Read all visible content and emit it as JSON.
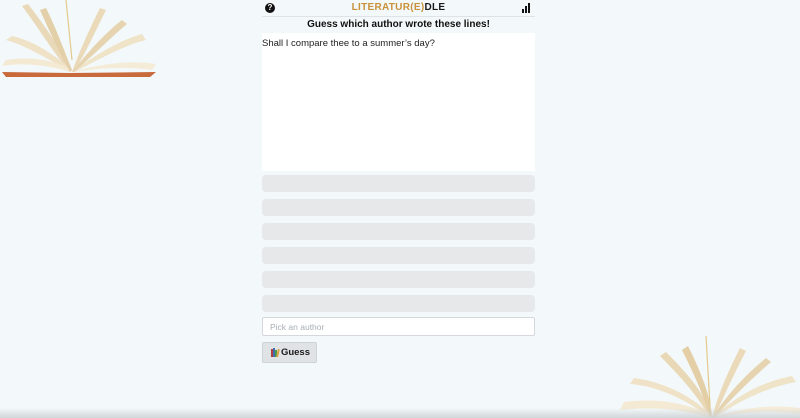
{
  "header": {
    "logo_accent": "LITERATUR(E)",
    "logo_plain": "DLE",
    "help_icon": "question-circle-icon",
    "stats_icon": "bar-chart-icon"
  },
  "prompt": {
    "title": "Guess which author wrote these lines!",
    "quote": "Shall I compare thee to a summer’s day?"
  },
  "guesses": [
    "",
    "",
    "",
    "",
    "",
    ""
  ],
  "input": {
    "placeholder": "Pick an author",
    "value": ""
  },
  "guess_button": {
    "icon": "books-icon",
    "label": "Guess"
  },
  "colors": {
    "accent": "#c8913a",
    "background": "#f3f8fa",
    "slot": "#e6e8ea"
  }
}
